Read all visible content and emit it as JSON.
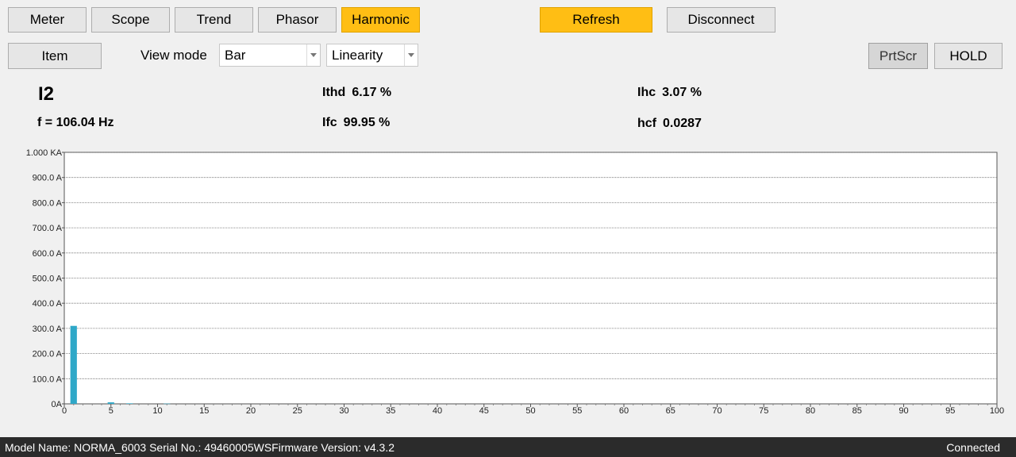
{
  "tabs": [
    "Meter",
    "Scope",
    "Trend",
    "Phasor",
    "Harmonic"
  ],
  "active_tab": "Harmonic",
  "actions": {
    "refresh": "Refresh",
    "disconnect": "Disconnect"
  },
  "toolbar": {
    "item": "Item",
    "view_mode_label": "View mode",
    "view_mode_value": "Bar",
    "scale_value": "Linearity",
    "prtscr": "PrtScr",
    "hold": "HOLD"
  },
  "measure": {
    "channel": "I2",
    "freq_text": "f = 106.04 Hz",
    "ithd_label": "Ithd",
    "ithd_value": "6.17 %",
    "ifc_label": "Ifc",
    "ifc_value": "99.95 %",
    "ihc_label": "Ihc",
    "ihc_value": "3.07 %",
    "hcf_label": "hcf",
    "hcf_value": "0.0287"
  },
  "status": {
    "left": "Model Name:  NORMA_6003 Serial No.:  49460005WSFirmware Version:  v4.3.2",
    "right": "Connected"
  },
  "colors": {
    "accent": "#ffbe14",
    "bar": "#2fa8c8"
  },
  "chart_data": {
    "type": "bar",
    "x_ticks": [
      0,
      5,
      10,
      15,
      20,
      25,
      30,
      35,
      40,
      45,
      50,
      55,
      60,
      65,
      70,
      75,
      80,
      85,
      90,
      95,
      100
    ],
    "y_ticks": [
      "0A",
      "100.0 A",
      "200.0 A",
      "300.0 A",
      "400.0 A",
      "500.0 A",
      "600.0 A",
      "700.0 A",
      "800.0 A",
      "900.0 A",
      "1.000 KA"
    ],
    "xlim": [
      0,
      100
    ],
    "ylim": [
      0,
      1000
    ],
    "grid": true,
    "points": [
      {
        "x": 1,
        "y": 310
      },
      {
        "x": 5,
        "y": 6
      },
      {
        "x": 7,
        "y": 2
      },
      {
        "x": 11,
        "y": 1
      }
    ]
  }
}
